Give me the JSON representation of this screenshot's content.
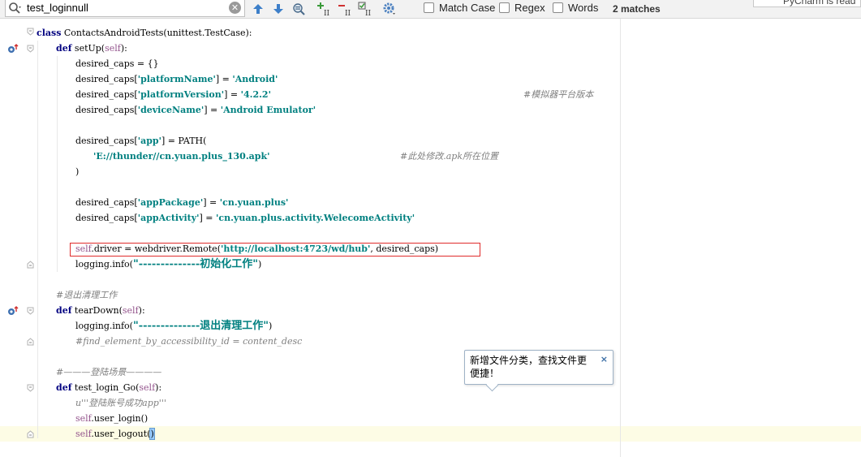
{
  "search": {
    "value": "test_loginnull",
    "match_case_label": "Match Case",
    "regex_label": "Regex",
    "words_label": "Words",
    "matches": "2 matches"
  },
  "right_panel": {
    "text": "PyCharm is read"
  },
  "code": {
    "l1": [
      "class",
      " ContactsAndroidTests(unittest.TestCase):"
    ],
    "l2": [
      "def",
      " setUp(",
      "self",
      "):"
    ],
    "l3": "desired_caps = {}",
    "l4": [
      "desired_caps[",
      "'platformName'",
      "] = ",
      "'Android'"
    ],
    "l5": [
      "desired_caps[",
      "'platformVersion'",
      "] = ",
      "'4.2.2'",
      "#模拟器平台版本"
    ],
    "l6": [
      "desired_caps[",
      "'deviceName'",
      "] = ",
      "'Android Emulator'"
    ],
    "l7": [
      "desired_caps[",
      "'app'",
      "] = PATH("
    ],
    "l8": [
      "'E://thunder//cn.yuan.plus_130.apk'",
      "#此处修改.apk所在位置"
    ],
    "l9": ")",
    "l10": [
      "desired_caps[",
      "'appPackage'",
      "] = ",
      "'cn.yuan.plus'"
    ],
    "l11": [
      "desired_caps[",
      "'appActivity'",
      "] = ",
      "'cn.yuan.plus.activity.WelecomeActivity'"
    ],
    "l12": [
      "self",
      ".driver = webdriver.Remote(",
      "'http://localhost:4723/wd/hub'",
      ", desired_caps)"
    ],
    "l13": [
      "logging.info(",
      "\"--------------初始化工作\"",
      ")"
    ],
    "l14": "#退出清理工作",
    "l15": [
      "def",
      " tearDown(",
      "self",
      "):"
    ],
    "l16": [
      "logging.info(",
      "\"--------------退出清理工作\"",
      ")"
    ],
    "l17": "#find_element_by_accessibility_id = content_desc",
    "l18": "#———登陆场景————",
    "l19": [
      "def",
      " test_login_Go(",
      "self",
      "):"
    ],
    "l20": [
      "u",
      "'''登陆账号成功app'''"
    ],
    "l21": [
      "self",
      ".user_login()"
    ],
    "l22": [
      "self",
      ".user_logout(",
      ")"
    ]
  },
  "tooltip": {
    "text": "新增文件分类，查找文件更便捷！",
    "close": "×"
  },
  "colors": {
    "keyword": "#000080",
    "string": "#008080",
    "self": "#94558d",
    "comment": "#808080",
    "highlight_box": "#e02b2b",
    "caret_line": "#fdfce5"
  },
  "icons": [
    "search-icon",
    "clear-icon",
    "prev-occurrence-icon",
    "next-occurrence-icon",
    "find-all-icon",
    "add-occurrence-icon",
    "remove-occurrence-icon",
    "select-all-occurrences-icon",
    "settings-icon",
    "override-icon",
    "fold-icon"
  ]
}
